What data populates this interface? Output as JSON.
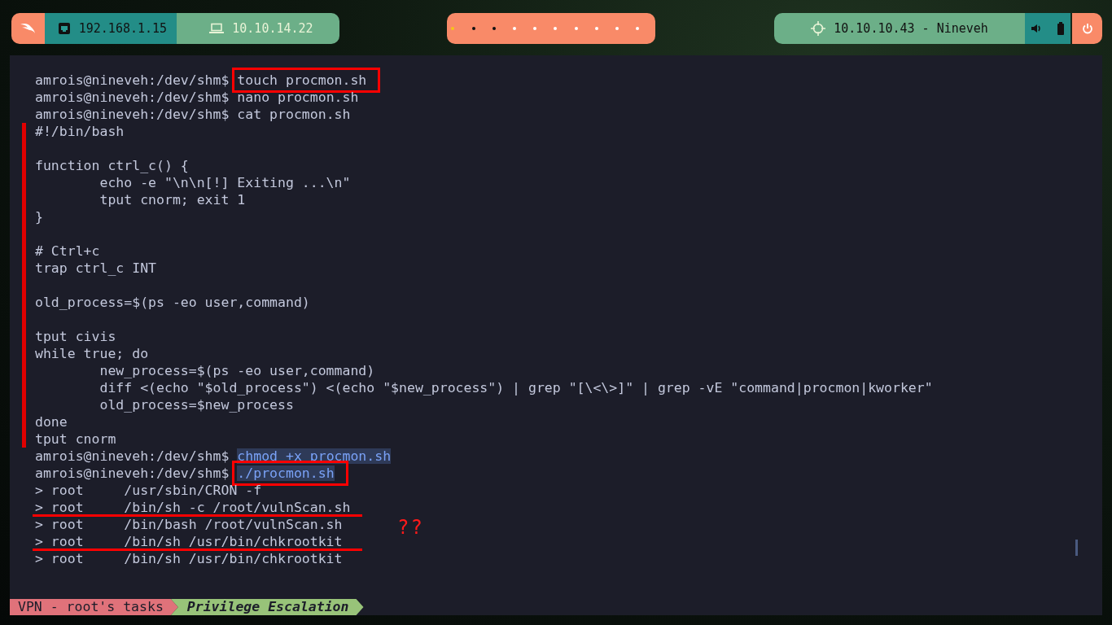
{
  "top_bar": {
    "left": [
      {
        "kind": "logo"
      },
      {
        "kind": "ethernet",
        "text": "192.168.1.15"
      },
      {
        "kind": "laptop",
        "text": "10.10.14.22"
      }
    ],
    "workspaces": [
      {
        "active": true
      },
      {
        "active": false,
        "occupied": true
      },
      {
        "active": false,
        "occupied": true
      },
      {
        "active": false,
        "occupied": false
      },
      {
        "active": false,
        "occupied": false
      },
      {
        "active": false,
        "occupied": false
      },
      {
        "active": false,
        "occupied": false
      },
      {
        "active": false,
        "occupied": false
      },
      {
        "active": false,
        "occupied": false
      },
      {
        "active": false,
        "occupied": false
      }
    ],
    "target": {
      "text": "10.10.10.43 - Nineveh"
    },
    "right": [
      {
        "kind": "volume"
      },
      {
        "kind": "battery"
      },
      {
        "kind": "power"
      }
    ]
  },
  "terminal": {
    "before": [
      {
        "prompt": "amrois@nineveh:/dev/shm$",
        "command": "touch procmon.sh",
        "selected": false,
        "boxed": true
      },
      {
        "prompt": "amrois@nineveh:/dev/shm$",
        "command": "nano procmon.sh",
        "selected": false,
        "boxed": false
      },
      {
        "prompt": "amrois@nineveh:/dev/shm$",
        "command": "cat procmon.sh",
        "selected": false,
        "boxed": false
      }
    ],
    "script": [
      {
        "kind": "text",
        "text": "#!/bin/bash"
      },
      {
        "kind": "blank"
      },
      {
        "kind": "text",
        "text": "function ctrl_c() {"
      },
      {
        "kind": "text",
        "text": "        echo -e \"\\n\\n[!] Exiting ...\\n\""
      },
      {
        "kind": "text",
        "text": "        tput cnorm; exit 1"
      },
      {
        "kind": "text",
        "text": "}"
      },
      {
        "kind": "blank"
      },
      {
        "kind": "text",
        "text": "# Ctrl+c"
      },
      {
        "kind": "text",
        "text": "trap ctrl_c INT"
      },
      {
        "kind": "blank"
      },
      {
        "kind": "text",
        "text": "old_process=$(ps -eo user,command)"
      },
      {
        "kind": "blank"
      },
      {
        "kind": "text",
        "text": "tput civis"
      },
      {
        "kind": "text",
        "text": "while true; do"
      },
      {
        "kind": "text",
        "text": "        new_process=$(ps -eo user,command)"
      },
      {
        "kind": "text",
        "text": "        diff <(echo \"$old_process\") <(echo \"$new_process\") | grep \"[\\<\\>]\" | grep -vE \"command|procmon|kworker\""
      },
      {
        "kind": "text",
        "text": "        old_process=$new_process"
      },
      {
        "kind": "text",
        "text": "done"
      },
      {
        "kind": "text",
        "text": "tput cnorm"
      }
    ],
    "after": [
      {
        "prompt": "amrois@nineveh:/dev/shm$",
        "command": "chmod +x procmon.sh",
        "selected": true,
        "boxed": false
      },
      {
        "prompt": "amrois@nineveh:/dev/shm$",
        "command": "./procmon.sh",
        "selected": true,
        "boxed": true
      }
    ],
    "output": [
      {
        "text": "> root     /usr/sbin/CRON -f",
        "underlined": false
      },
      {
        "text": "> root     /bin/sh -c /root/vulnScan.sh",
        "underlined": true
      },
      {
        "text": "> root     /bin/bash /root/vulnScan.sh",
        "underlined": false
      },
      {
        "text": "> root     /bin/sh /usr/bin/chkrootkit",
        "underlined": true
      },
      {
        "text": "> root     /bin/sh /usr/bin/chkrootkit",
        "underlined": false
      }
    ],
    "note": "??",
    "status": [
      {
        "text": "VPN - root's tasks",
        "color": "#e0727a",
        "italic": false
      },
      {
        "text": "Privilege Escalation",
        "color": "#98c379",
        "italic": true
      }
    ]
  }
}
